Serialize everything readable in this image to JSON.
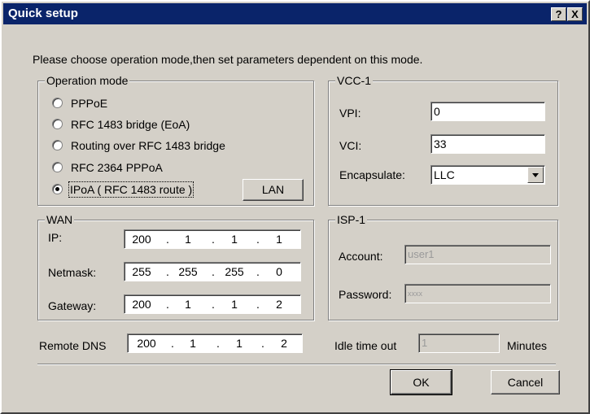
{
  "window": {
    "title": "Quick setup",
    "help_label": "?",
    "close_label": "X"
  },
  "instruction": "Please choose operation mode,then set parameters dependent on  this mode.",
  "operation_mode": {
    "legend": "Operation mode",
    "options": [
      "PPPoE",
      "RFC 1483 bridge (EoA)",
      "Routing over RFC 1483 bridge",
      "RFC 2364 PPPoA",
      "IPoA ( RFC 1483 route )"
    ],
    "selected": "IPoA ( RFC 1483 route )",
    "lan_button": "LAN"
  },
  "vcc": {
    "legend": "VCC-1",
    "vpi_label": "VPI:",
    "vpi_value": "0",
    "vci_label": "VCI:",
    "vci_value": "33",
    "encap_label": "Encapsulate:",
    "encap_value": "LLC"
  },
  "wan": {
    "legend": "WAN",
    "ip_label": "IP:",
    "ip": [
      "200",
      "1",
      "1",
      "1"
    ],
    "netmask_label": "Netmask:",
    "netmask": [
      "255",
      "255",
      "255",
      "0"
    ],
    "gateway_label": "Gateway:",
    "gateway": [
      "200",
      "1",
      "1",
      "2"
    ]
  },
  "isp": {
    "legend": "ISP-1",
    "account_label": "Account:",
    "account_value": "user1",
    "password_label": "Password:",
    "password_value": "xxxx"
  },
  "dns": {
    "label": "Remote DNS",
    "value": [
      "200",
      "1",
      "1",
      "2"
    ]
  },
  "idle": {
    "label": "Idle time out",
    "value": "1",
    "unit": "Minutes"
  },
  "buttons": {
    "ok": "OK",
    "cancel": "Cancel"
  }
}
